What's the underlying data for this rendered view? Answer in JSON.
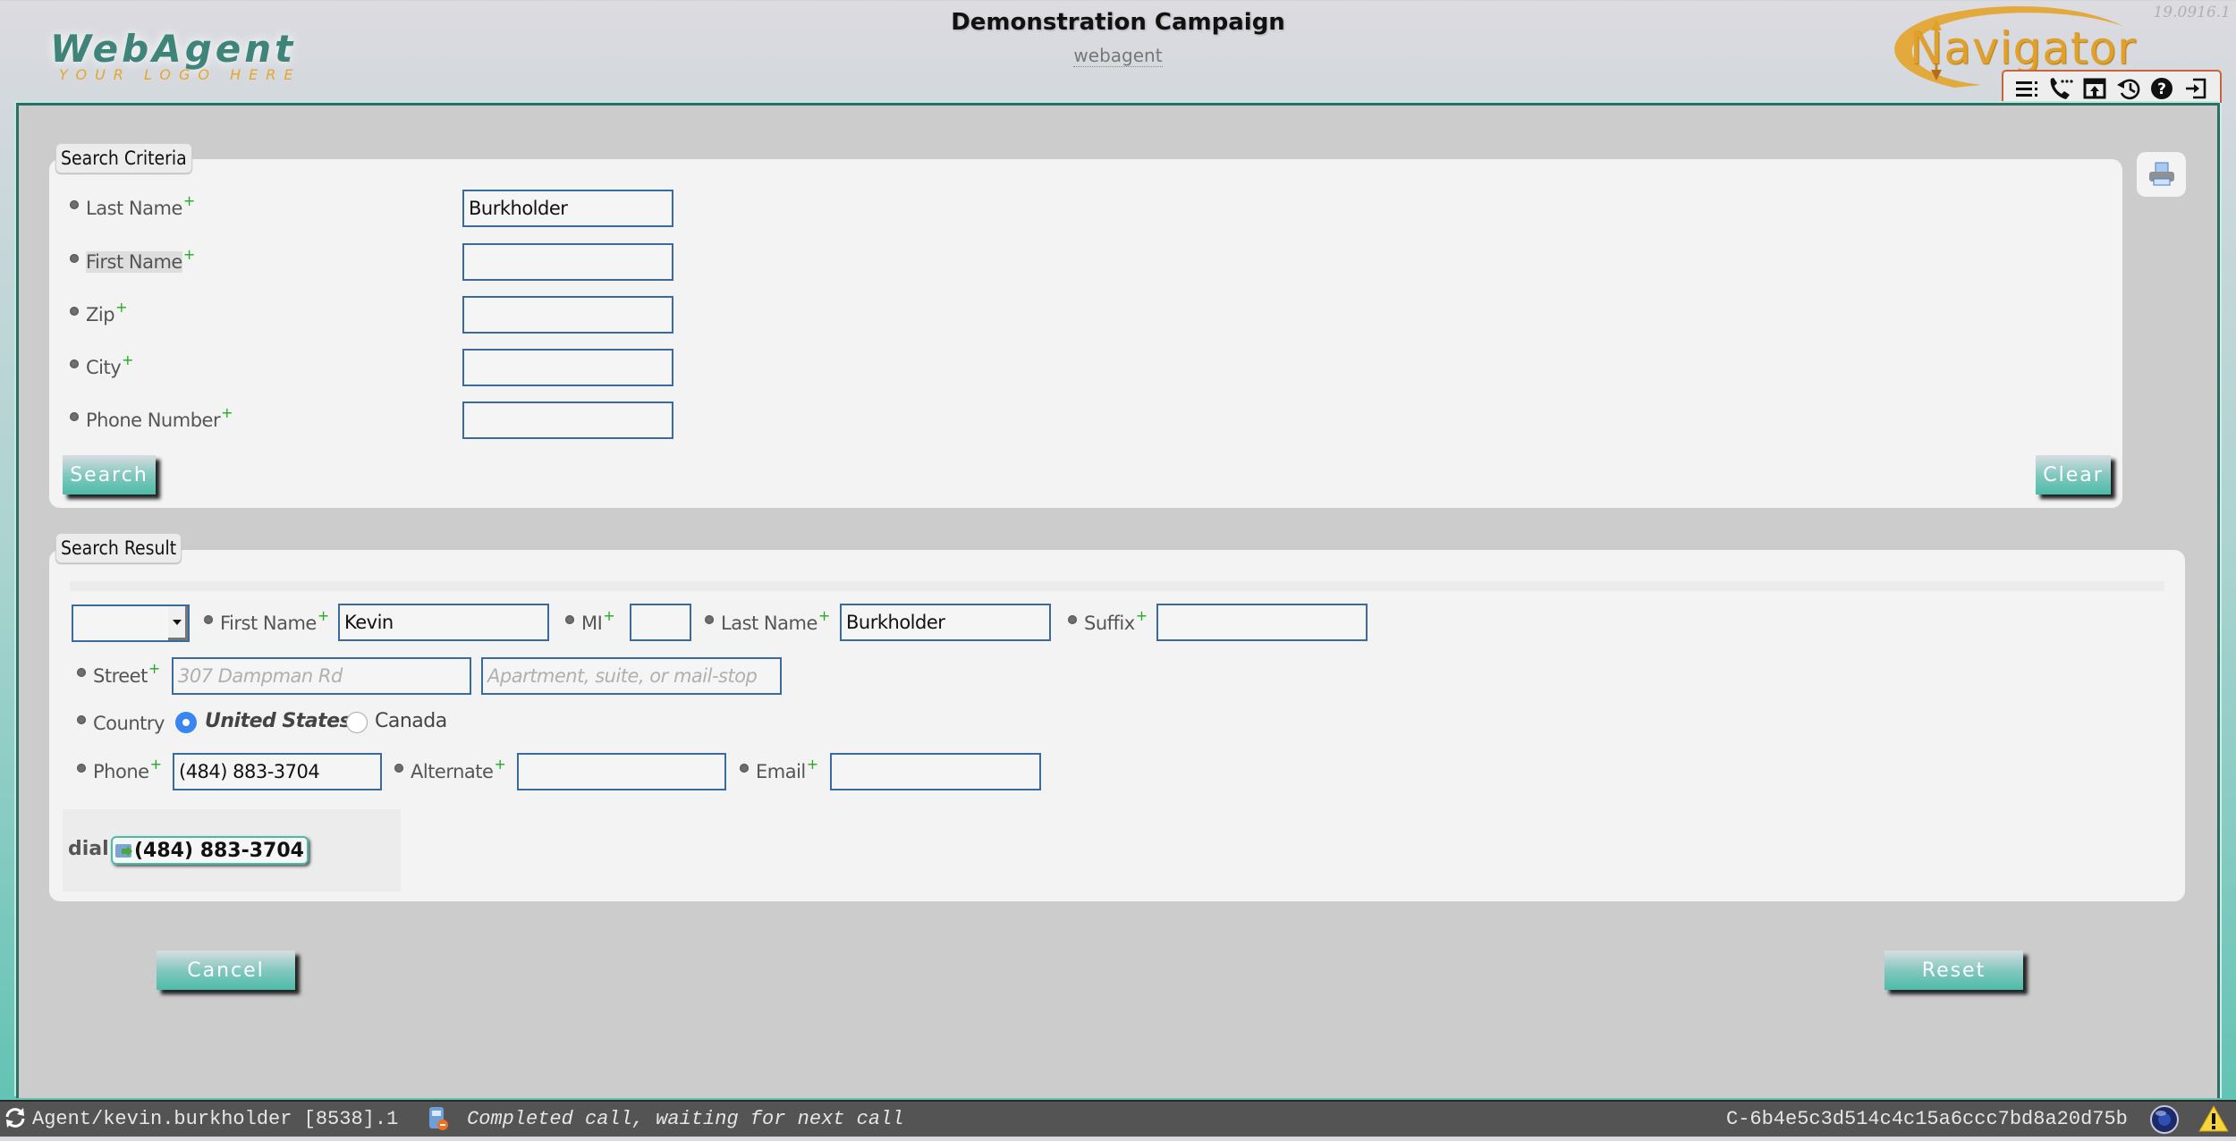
{
  "header": {
    "logo_main": "WebAgent",
    "logo_tagline": "YOUR LOGO HERE",
    "campaign_title": "Demonstration Campaign",
    "campaign_subtitle": "webagent",
    "version": "19.0916.1",
    "brand_logo": "Navigator",
    "toolbar_icons": [
      "menu-list-icon",
      "call-icon",
      "popout-icon",
      "history-icon",
      "help-icon",
      "logout-icon"
    ]
  },
  "search_criteria": {
    "legend": "Search Criteria",
    "fields": [
      {
        "label": "Last Name",
        "value": "Burkholder"
      },
      {
        "label": "First Name",
        "value": ""
      },
      {
        "label": "Zip",
        "value": ""
      },
      {
        "label": "City",
        "value": ""
      },
      {
        "label": "Phone Number",
        "value": ""
      }
    ],
    "required_marker": "+",
    "search_label": "Search",
    "clear_label": "Clear",
    "print_icon": "printer-icon"
  },
  "search_result": {
    "legend": "Search Result",
    "salutation_value": "",
    "first_name": {
      "label": "First Name",
      "value": "Kevin"
    },
    "mi": {
      "label": "MI",
      "value": ""
    },
    "last_name": {
      "label": "Last Name",
      "value": "Burkholder"
    },
    "suffix": {
      "label": "Suffix",
      "value": ""
    },
    "street": {
      "label": "Street",
      "placeholder1": "307 Dampman Rd",
      "placeholder2": "Apartment, suite, or mail-stop"
    },
    "country": {
      "label": "Country",
      "options": [
        "United States",
        "Canada"
      ],
      "selected": "United States"
    },
    "phone": {
      "label": "Phone",
      "value": "(484) 883-3704"
    },
    "alternate": {
      "label": "Alternate",
      "value": ""
    },
    "email": {
      "label": "Email",
      "value": ""
    },
    "dial": {
      "label": "dial",
      "number": "(484) 883-3704"
    }
  },
  "actions": {
    "cancel_label": "Cancel",
    "reset_label": "Reset"
  },
  "status_bar": {
    "agent": "Agent/kevin.burkholder [8538].1",
    "call_status": "Completed call, waiting for next call",
    "session_id": "C-6b4e5c3d514c4c15a6ccc7bd8a20d75b"
  },
  "colors": {
    "accent_teal": "#4dbba8",
    "frame_border": "#2f6f63",
    "field_border": "#3a6aa0",
    "required_plus": "#22aa22",
    "radio_selected": "#3a86f0",
    "logo_teal": "#3f8479",
    "logo_orange": "#e6a62c"
  }
}
